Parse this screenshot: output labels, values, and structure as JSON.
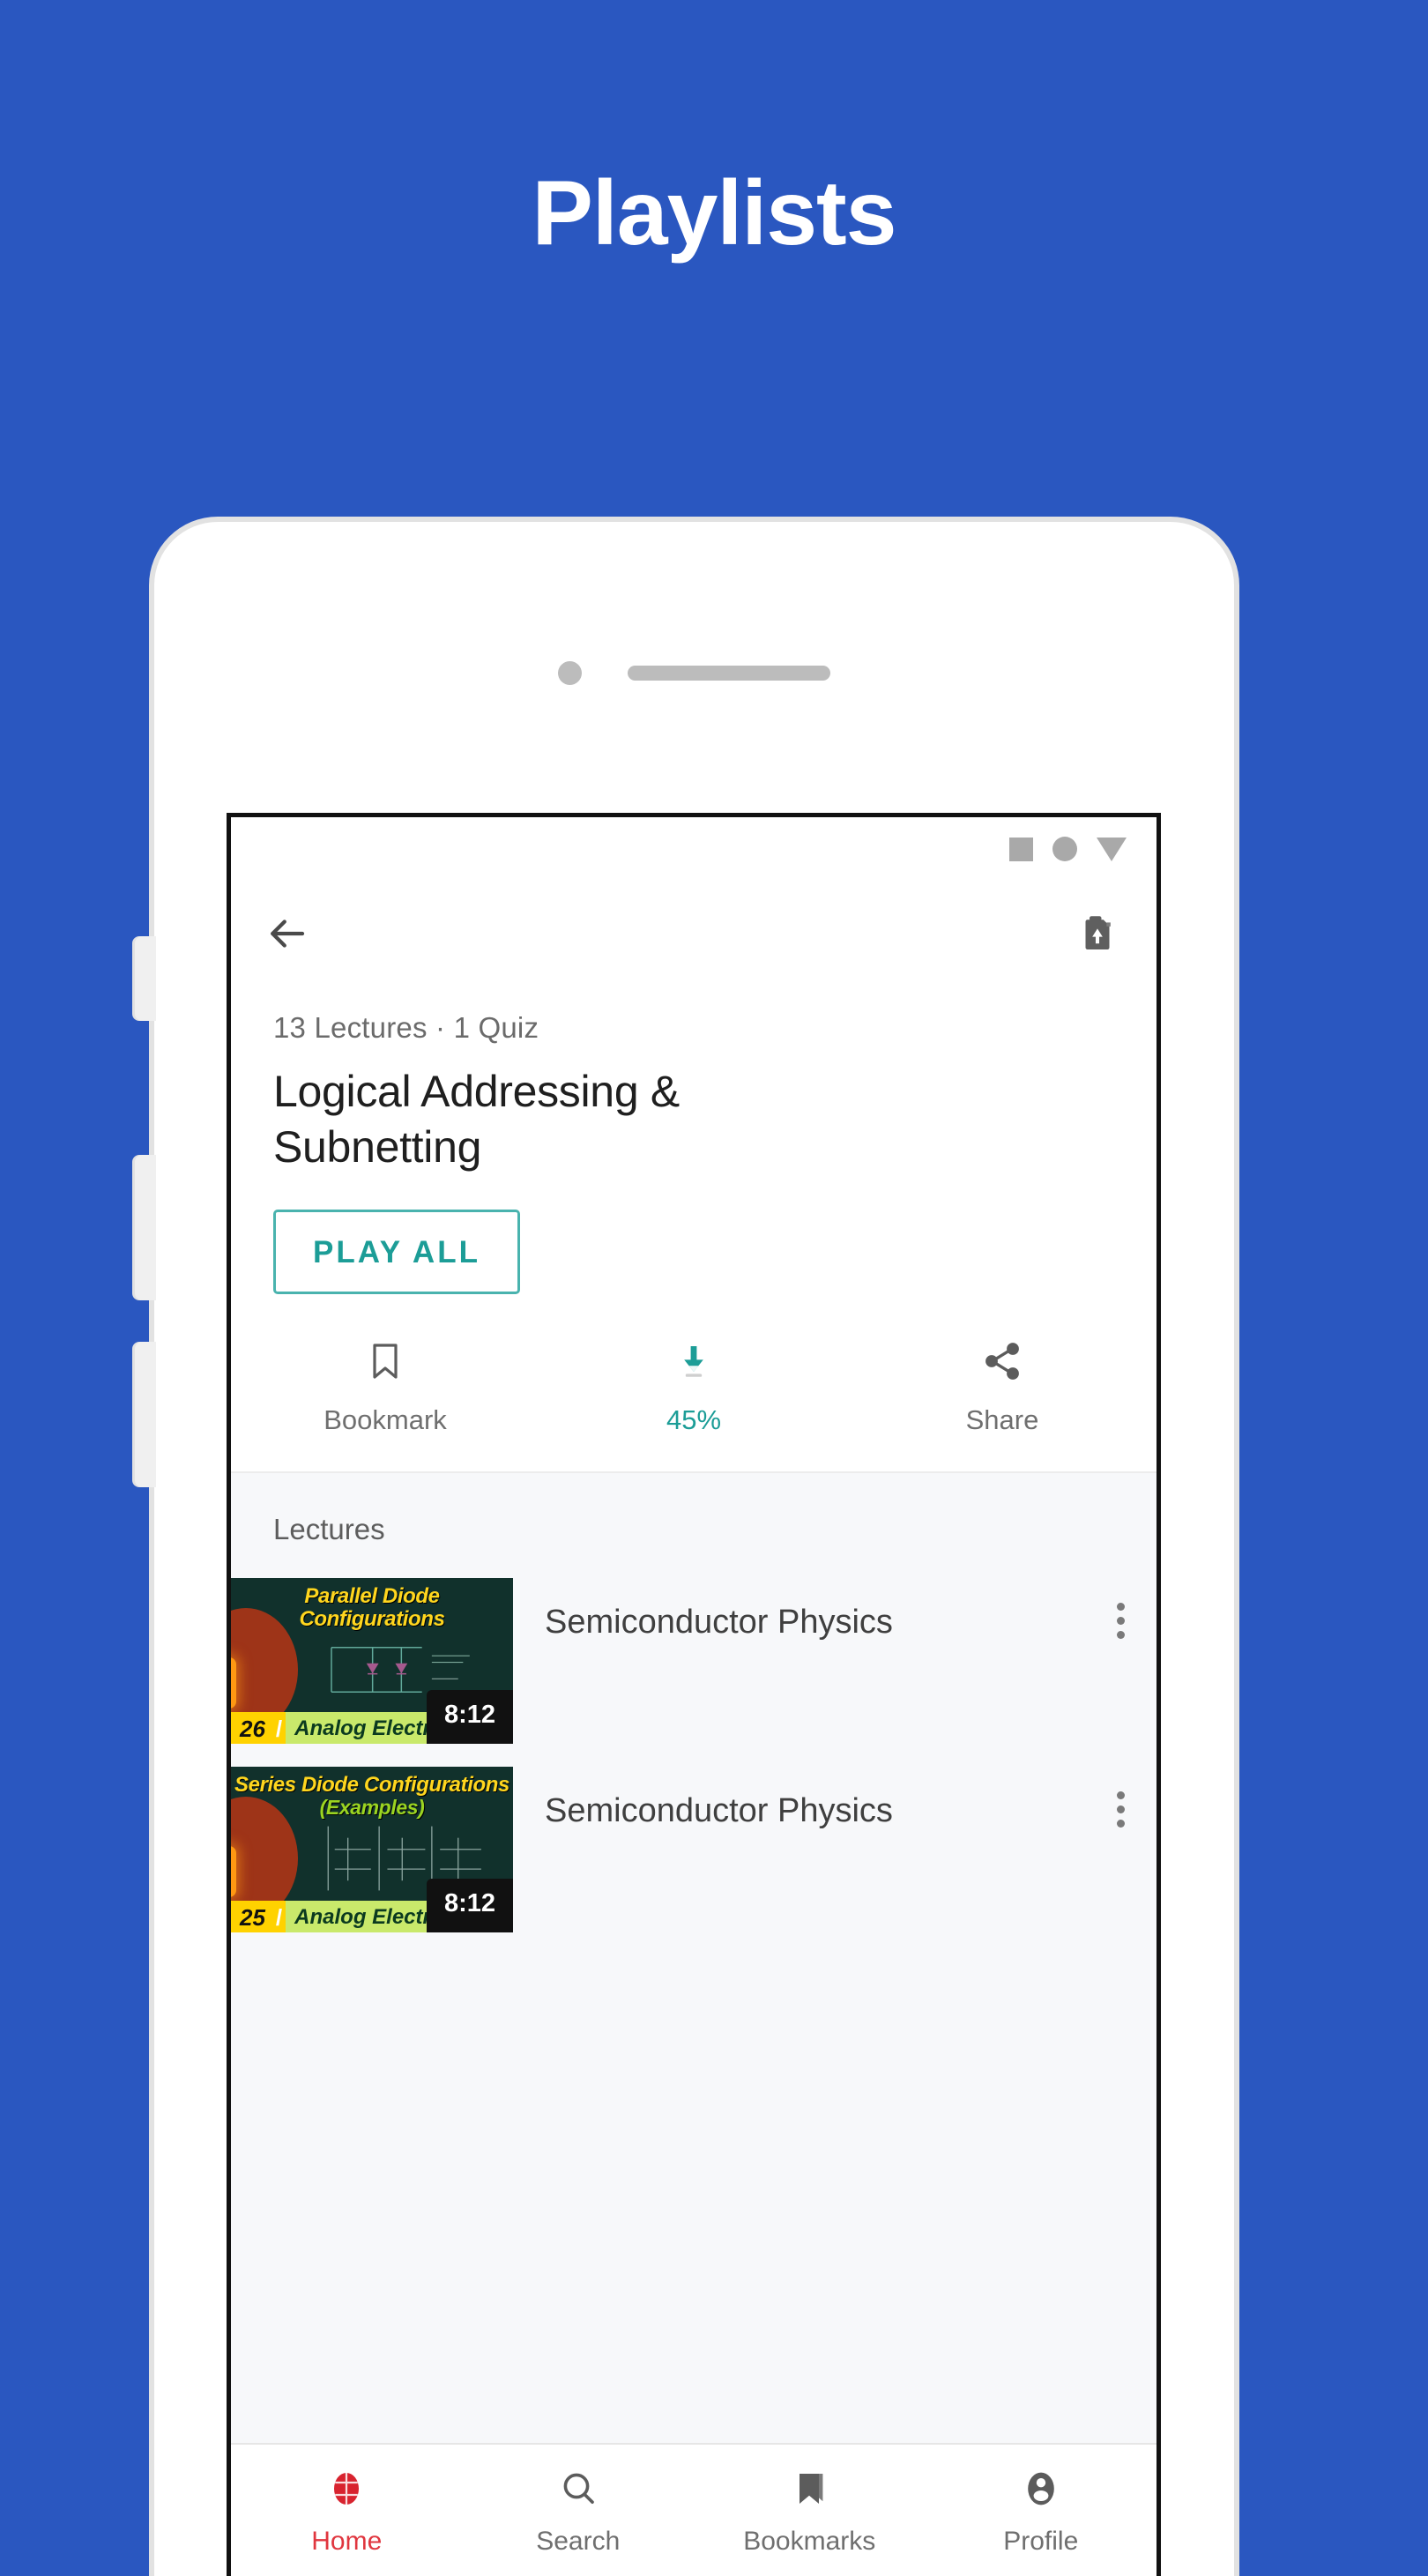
{
  "headline": "Playlists",
  "colors": {
    "background_blue": "#2a57c0",
    "accent_teal": "#1c9d97",
    "active_nav_red": "#e0363f",
    "thumb_dark": "#11312c"
  },
  "statusbar": {
    "icons": [
      "square-icon",
      "circle-icon",
      "wifi-triangle-icon"
    ]
  },
  "appbar": {
    "back_icon": "back-arrow-icon",
    "download_icon": "download-video-icon"
  },
  "playlist": {
    "meta": "13 Lectures · 1 Quiz",
    "title": "Logical Addressing & Subnetting",
    "play_all_label": "PLAY ALL"
  },
  "actions": [
    {
      "icon": "bookmark-icon",
      "label": "Bookmark",
      "accent": false
    },
    {
      "icon": "download-icon",
      "label": "45%",
      "accent": true
    },
    {
      "icon": "share-icon",
      "label": "Share",
      "accent": false
    }
  ],
  "lectures_section": {
    "heading": "Lectures",
    "items": [
      {
        "thumb_title": "Parallel Diode Configurations",
        "thumb_subtitle": "",
        "badge_number": "26",
        "badge_name": "Analog Electronics",
        "duration": "8:12",
        "title": "Semiconductor Physics",
        "menu_icon": "kebab-menu-icon"
      },
      {
        "thumb_title": "Series Diode Configurations",
        "thumb_subtitle": "(Examples)",
        "badge_number": "25",
        "badge_name": "Analog Electronics",
        "duration": "8:12",
        "title": "Semiconductor Physics",
        "menu_icon": "kebab-menu-icon"
      }
    ]
  },
  "bottom_nav": [
    {
      "icon": "home-icon",
      "label": "Home",
      "active": true
    },
    {
      "icon": "search-icon",
      "label": "Search",
      "active": false
    },
    {
      "icon": "bookmarks-icon",
      "label": "Bookmarks",
      "active": false
    },
    {
      "icon": "profile-icon",
      "label": "Profile",
      "active": false
    }
  ]
}
